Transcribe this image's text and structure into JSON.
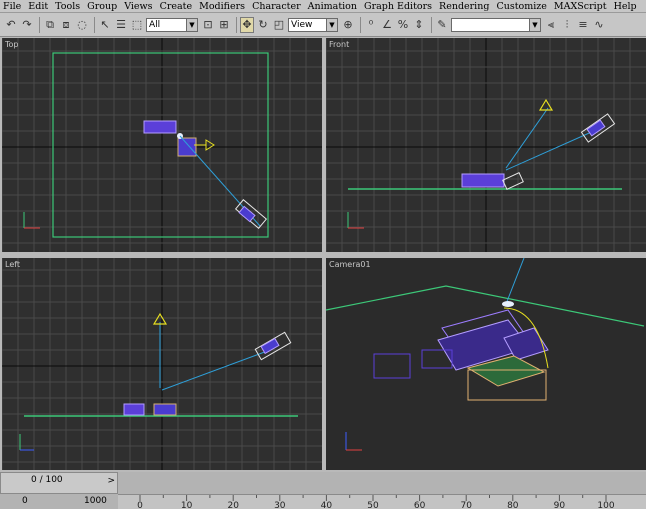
{
  "menu": [
    "File",
    "Edit",
    "Tools",
    "Group",
    "Views",
    "Create",
    "Modifiers",
    "Character",
    "Animation",
    "Graph Editors",
    "Rendering",
    "Customize",
    "MAXScript",
    "Help"
  ],
  "toolbar": {
    "selection_filter": "All",
    "reference_coord": "View",
    "named_selection": ""
  },
  "viewports": {
    "top": "Top",
    "front": "Front",
    "left": "Left",
    "camera": "Camera01"
  },
  "time_slider": {
    "display": "0 / 100",
    "arrow": ">"
  },
  "frame_readout": {
    "prefix": "0",
    "value": "1000"
  },
  "track_ticks": [
    "0",
    "10",
    "20",
    "30",
    "40",
    "50",
    "60",
    "70",
    "80",
    "90",
    "100"
  ],
  "colors": {
    "viewport_bg": "#2f2f2f",
    "grid": "#4a4a4a",
    "grid_axis": "#0a0a0a",
    "ground": "#3cc878",
    "camera_line": "#2e9fd8",
    "light": "#e8e020",
    "sofa": "#7c5cff"
  }
}
